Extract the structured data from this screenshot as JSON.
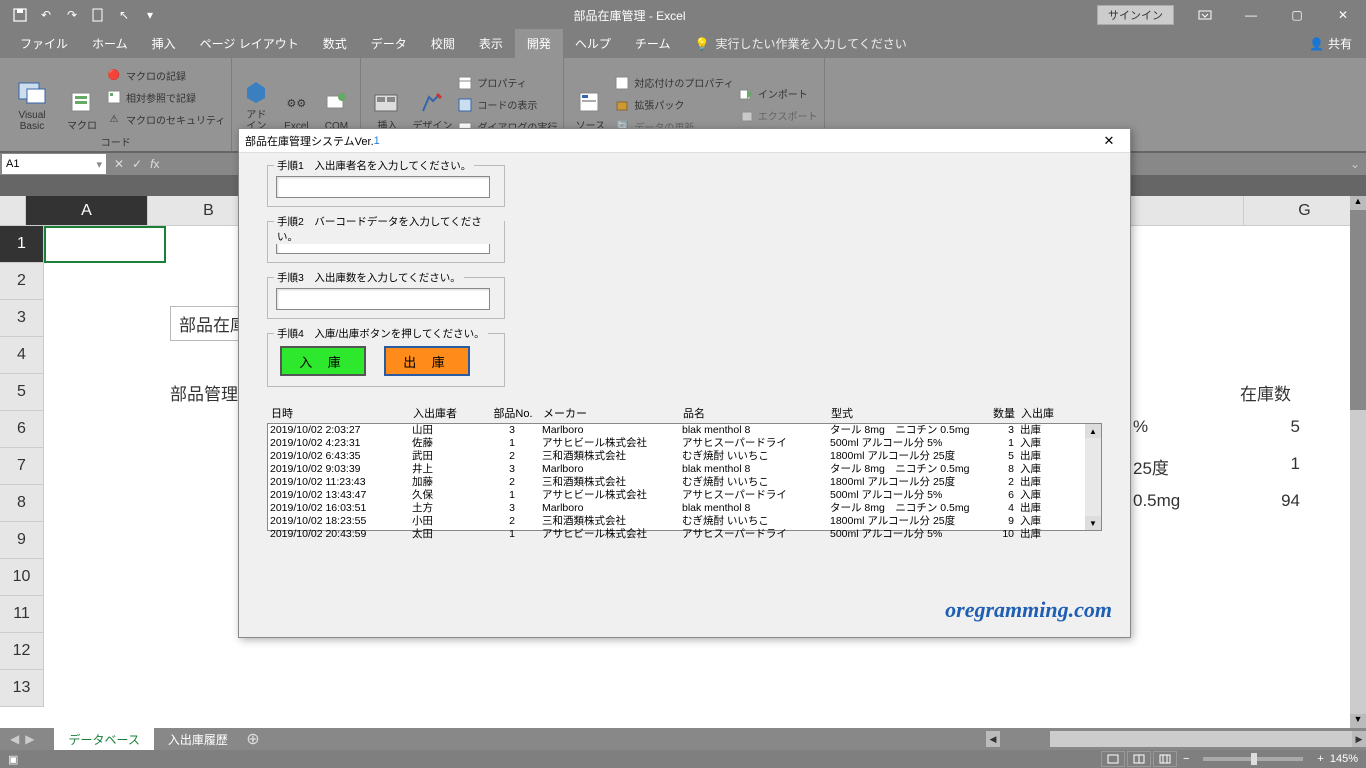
{
  "app": {
    "title": "部品在庫管理 - Excel",
    "signin": "サインイン"
  },
  "tabs": {
    "file": "ファイル",
    "home": "ホーム",
    "insert": "挿入",
    "layout": "ページ レイアウト",
    "formula": "数式",
    "data": "データ",
    "review": "校閲",
    "view": "表示",
    "dev": "開発",
    "help": "ヘルプ",
    "team": "チーム",
    "tell": "実行したい作業を入力してください",
    "share": "共有"
  },
  "ribbon": {
    "vb": "Visual Basic",
    "macro": "マクロ",
    "rec": "マクロの記録",
    "relref": "相対参照で記録",
    "sec": "マクロのセキュリティ",
    "code_label": "コード",
    "addin": "アド",
    "addin2": "イン",
    "excel": "Excel",
    "com": "COM",
    "insert": "挿入",
    "design": "デザイン",
    "prop": "プロパティ",
    "codeview": "コードの表示",
    "dlgexec": "ダイアログの実行",
    "src": "ソース",
    "mapprop": "対応付けのプロパティ",
    "exp": "拡張パック",
    "refresh": "データの更新",
    "import": "インポート",
    "export": "エクスポート"
  },
  "fbar": {
    "ref": "A1"
  },
  "cols": [
    "A",
    "B",
    "",
    "",
    "",
    "",
    "",
    "",
    "",
    "G"
  ],
  "sheet": {
    "b3_partial": "部品在庫",
    "b5_partial": "部品管理",
    "g5": "在庫数",
    "f6_partial": "%",
    "g6": "5",
    "f7_partial": "25度",
    "g7": "1",
    "f8_partial": "0.5mg",
    "g8": "94"
  },
  "sheettabs": {
    "t1": "データベース",
    "t2": "入出庫履歴"
  },
  "status": {
    "rec": "",
    "zoom": "145%"
  },
  "dialog": {
    "title_a": "部品在庫管理システムVer.",
    "title_b": "1",
    "step1": "手順1　入出庫者名を入力してください。",
    "step2": "手順2　バーコードデータを入力してください。",
    "step3": "手順3　入出庫数を入力してください。",
    "step4": "手順4　入庫/出庫ボタンを押してください。",
    "btn_in": "入 庫",
    "btn_out": "出 庫",
    "hdr": {
      "dt": "日時",
      "pe": "入出庫者",
      "pn": "部品No.",
      "mk": "メーカー",
      "nm": "品名",
      "md": "型式",
      "qt": "数量",
      "io": "入出庫"
    },
    "rows": [
      {
        "dt": "2019/10/02 2:03:27",
        "pe": "山田",
        "pn": "3",
        "mk": "Marlboro",
        "nm": "blak menthol 8",
        "md": "タール 8mg　ニコチン 0.5mg",
        "qt": "3",
        "io": "出庫"
      },
      {
        "dt": "2019/10/02 4:23:31",
        "pe": "佐藤",
        "pn": "1",
        "mk": "アサヒビール株式会社",
        "nm": "アサヒスーパードライ",
        "md": "500ml アルコール分 5%",
        "qt": "1",
        "io": "入庫"
      },
      {
        "dt": "2019/10/02 6:43:35",
        "pe": "武田",
        "pn": "2",
        "mk": "三和酒類株式会社",
        "nm": "むぎ焼酎 いいちこ",
        "md": "1800ml アルコール分 25度",
        "qt": "5",
        "io": "出庫"
      },
      {
        "dt": "2019/10/02 9:03:39",
        "pe": "井上",
        "pn": "3",
        "mk": "Marlboro",
        "nm": "blak menthol 8",
        "md": "タール 8mg　ニコチン 0.5mg",
        "qt": "8",
        "io": "入庫"
      },
      {
        "dt": "2019/10/02 11:23:43",
        "pe": "加藤",
        "pn": "2",
        "mk": "三和酒類株式会社",
        "nm": "むぎ焼酎 いいちこ",
        "md": "1800ml アルコール分 25度",
        "qt": "2",
        "io": "出庫"
      },
      {
        "dt": "2019/10/02 13:43:47",
        "pe": "久保",
        "pn": "1",
        "mk": "アサヒビール株式会社",
        "nm": "アサヒスーパードライ",
        "md": "500ml アルコール分 5%",
        "qt": "6",
        "io": "入庫"
      },
      {
        "dt": "2019/10/02 16:03:51",
        "pe": "土方",
        "pn": "3",
        "mk": "Marlboro",
        "nm": "blak menthol 8",
        "md": "タール 8mg　ニコチン 0.5mg",
        "qt": "4",
        "io": "出庫"
      },
      {
        "dt": "2019/10/02 18:23:55",
        "pe": "小田",
        "pn": "2",
        "mk": "三和酒類株式会社",
        "nm": "むぎ焼酎 いいちこ",
        "md": "1800ml アルコール分 25度",
        "qt": "9",
        "io": "入庫"
      },
      {
        "dt": "2019/10/02 20:43:59",
        "pe": "太田",
        "pn": "1",
        "mk": "アサヒビール株式会社",
        "nm": "アサヒスーパードライ",
        "md": "500ml アルコール分 5%",
        "qt": "10",
        "io": "出庫"
      }
    ],
    "watermark": "oregramming.com"
  }
}
